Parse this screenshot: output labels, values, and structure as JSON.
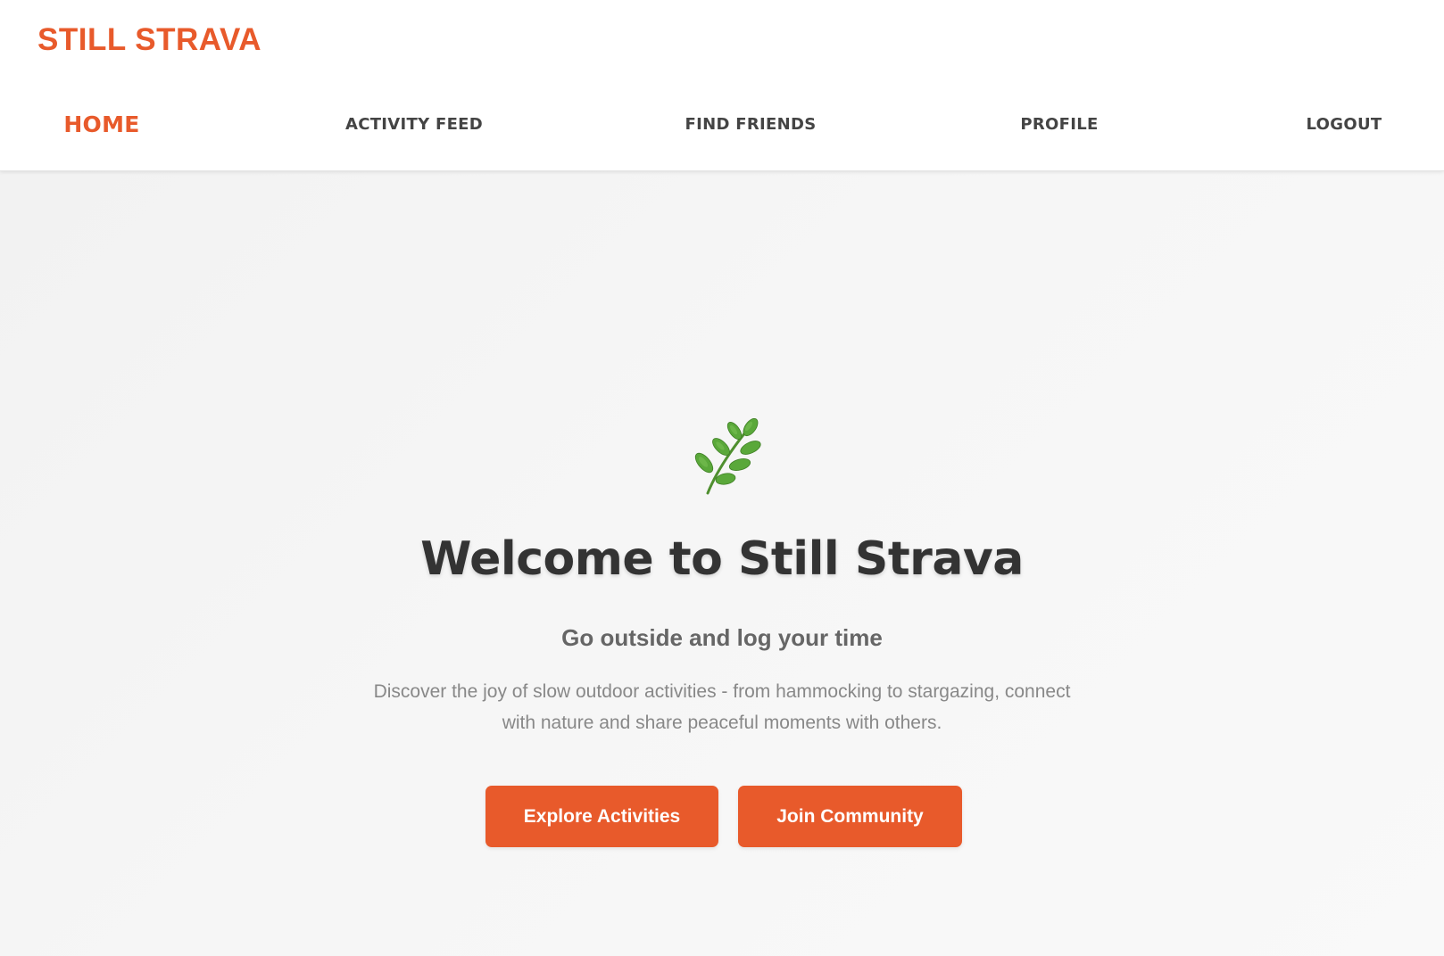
{
  "header": {
    "logo_text": "STILL STRAVA",
    "nav": [
      {
        "label": "HOME",
        "active": true
      },
      {
        "label": "ACTIVITY FEED",
        "active": false
      },
      {
        "label": "FIND FRIENDS",
        "active": false
      },
      {
        "label": "PROFILE",
        "active": false
      },
      {
        "label": "LOGOUT",
        "active": false
      }
    ]
  },
  "hero": {
    "icon": "herb-leaf-icon",
    "title": "Welcome to Still Strava",
    "subtitle": "Go outside and log your time",
    "description": "Discover the joy of slow outdoor activities - from hammocking to stargazing, connect with nature and share peaceful moments with others.",
    "buttons": {
      "explore_label": "Explore Activities",
      "join_label": "Join Community"
    }
  },
  "colors": {
    "brand": "#e85a2b",
    "nav_text": "#444444",
    "title_text": "#333333",
    "subtitle_text": "#666666",
    "body_text": "#888888",
    "hero_background": "#f5f5f5",
    "leaf_green": "#5aa83a"
  }
}
